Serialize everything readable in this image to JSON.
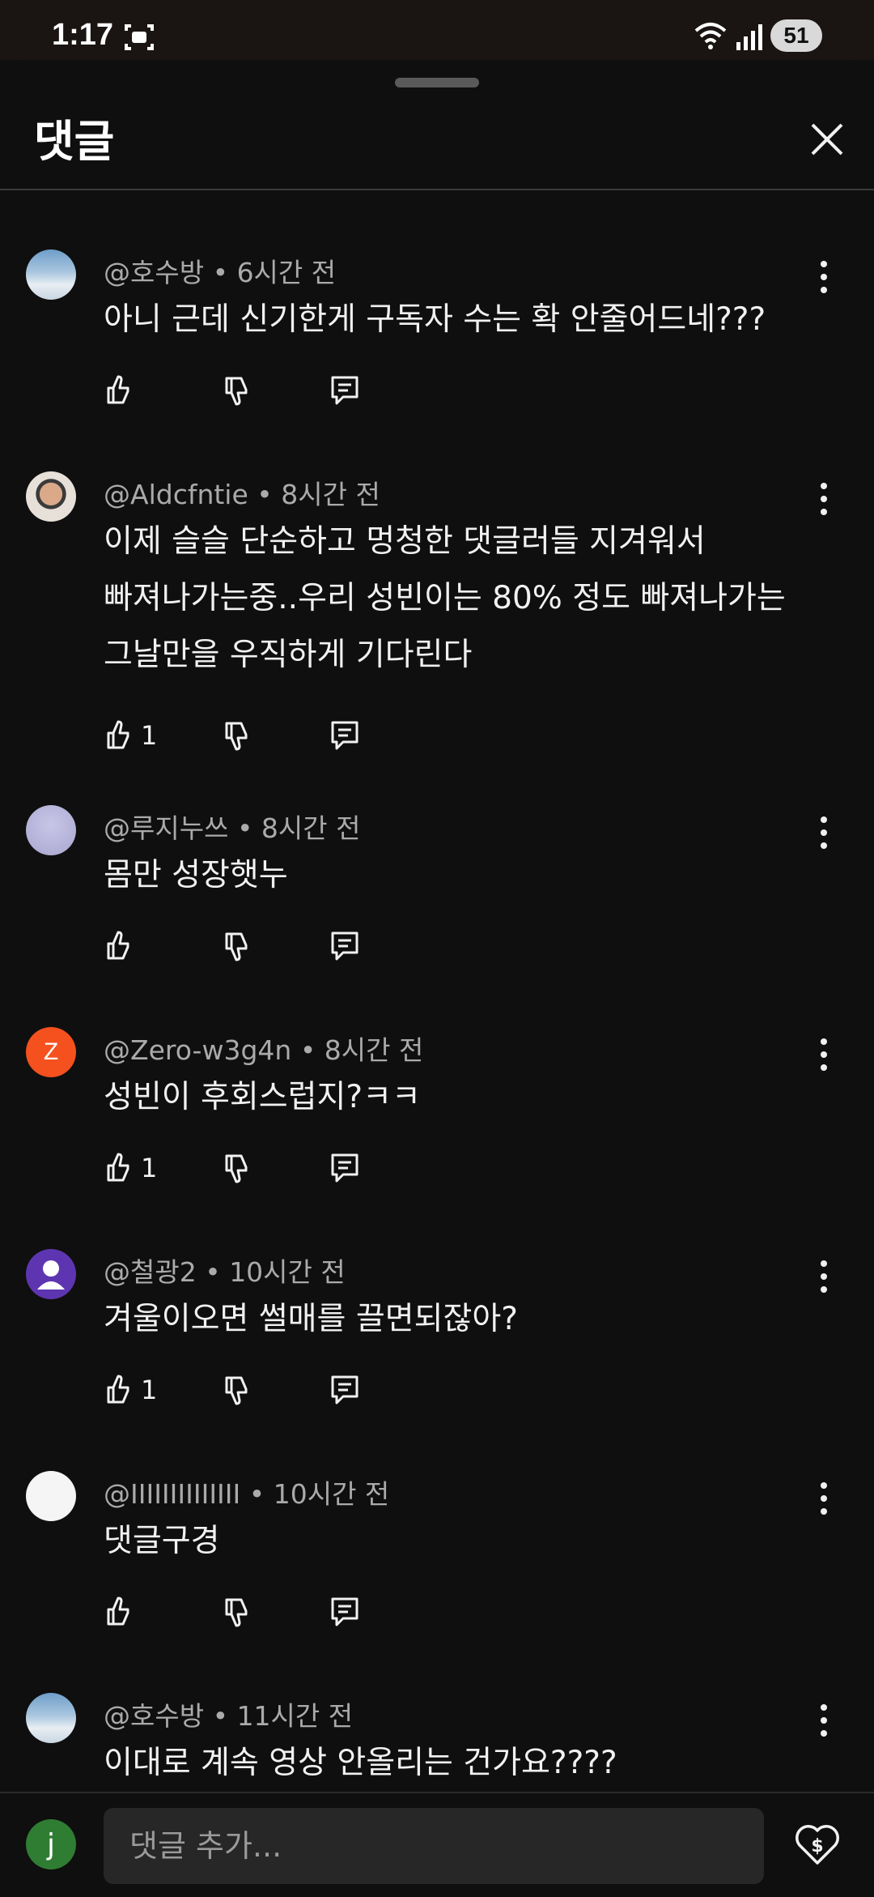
{
  "status": {
    "time": "1:17",
    "battery": "51"
  },
  "header": {
    "title": "댓글"
  },
  "comments": [
    {
      "author": "@호수방",
      "time": "6시간 전",
      "text": "아니 근데 신기한게 구독자 수는 확 안줄어드네???",
      "likes": "",
      "avatar": "sky"
    },
    {
      "author": "@Aldcfntie",
      "time": "8시간 전",
      "lines": [
        "이제 슬슬 단순하고 멍청한 댓글러들 지겨워서",
        "빠져나가는중..우리 성빈이는 80% 정도 빠져나가는",
        "그날만을 우직하게 기다린다"
      ],
      "likes": "1",
      "avatar": "photo"
    },
    {
      "author": "@루지누쓰",
      "time": "8시간 전",
      "text": "몸만 성장햇누",
      "likes": "",
      "avatar": "lavender"
    },
    {
      "author": "@Zero-w3g4n",
      "time": "8시간 전",
      "text": "성빈이 후회스럽지?ㅋㅋ",
      "likes": "1",
      "avatar": "Z",
      "avatar_color": "#f4511e"
    },
    {
      "author": "@철광2",
      "time": "10시간 전",
      "text": "겨울이오면 썰매를 끌면되잖아?",
      "likes": "1",
      "avatar": "person",
      "avatar_color": "#5e35b1"
    },
    {
      "author": "@IIIIIIIIIIIIII",
      "time": "10시간 전",
      "text": "댓글구경",
      "likes": "",
      "avatar": "white"
    },
    {
      "author": "@호수방",
      "time": "11시간 전",
      "text": "이대로 계속 영상 안올리는 건가요????",
      "likes": "",
      "avatar": "sky"
    }
  ],
  "footer": {
    "user_initial": "j",
    "input_placeholder": "댓글 추가..."
  }
}
